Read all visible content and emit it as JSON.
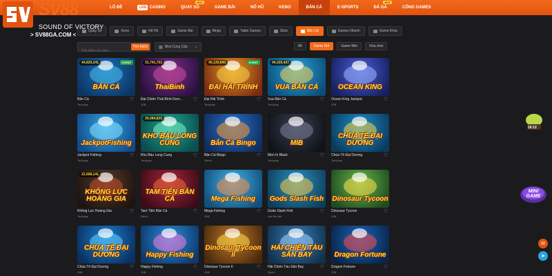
{
  "brand": {
    "logo_text": "SV88",
    "tagline": "SOUND OF VICTORY",
    "url": "> SV88GA.COM <",
    "accent": "#f26a1b"
  },
  "nav": [
    {
      "label": "LÔ ĐỀ",
      "live": false,
      "hot": false,
      "active": false
    },
    {
      "label": "CASINO",
      "live": true,
      "hot": false,
      "active": false
    },
    {
      "label": "QUAY SỐ",
      "live": false,
      "hot": true,
      "active": false
    },
    {
      "label": "GAME BÀI",
      "live": false,
      "hot": false,
      "active": false
    },
    {
      "label": "NỔ HŨ",
      "live": false,
      "hot": false,
      "active": false
    },
    {
      "label": "KENO",
      "live": false,
      "hot": false,
      "active": false
    },
    {
      "label": "BẮN CÁ",
      "live": false,
      "hot": false,
      "active": true
    },
    {
      "label": "E-SPORTS",
      "live": false,
      "hot": false,
      "active": false
    },
    {
      "label": "ĐÁ GÀ",
      "live": false,
      "hot": true,
      "active": false
    },
    {
      "label": "CỔNG GAMES",
      "live": false,
      "hot": false,
      "active": false
    }
  ],
  "nav_badges": {
    "live": "LIVE",
    "hot": "HOT"
  },
  "categories": [
    {
      "label": "Quay Số",
      "active": false
    },
    {
      "label": "Keno",
      "active": false
    },
    {
      "label": "Nổ Hũ",
      "active": false
    },
    {
      "label": "Game Bài",
      "active": false
    },
    {
      "label": "Bingo",
      "active": false
    },
    {
      "label": "Table Games",
      "active": false
    },
    {
      "label": "Slots",
      "active": false
    },
    {
      "label": "Bắn Cá",
      "active": true
    },
    {
      "label": "Games Nhanh",
      "active": false
    },
    {
      "label": "Game Khác",
      "active": false
    }
  ],
  "search": {
    "placeholder": "Tìm kiếm trò chơi...",
    "button": "Tìm Kiếm"
  },
  "provider_select": {
    "value": "Nhà Cung Cấp",
    "chevron": "⌄"
  },
  "filters": [
    {
      "label": "All",
      "active": false
    },
    {
      "label": "Game Hot",
      "active": true
    },
    {
      "label": "Game Mới",
      "active": false
    },
    {
      "label": "Vừa chơi",
      "active": false
    }
  ],
  "games": [
    {
      "name": "Bắn Cá",
      "provider": "Techplay",
      "art_text": "BẮN CÁ",
      "jackpot": "44,829,241",
      "event": "EVENT",
      "c1": "#1d6fb8",
      "c2": "#0c3564",
      "d": "#4ac1f0"
    },
    {
      "name": "Đại Chiến Thái Bình Dươ...",
      "provider": "JDB",
      "art_text": "ThaiBinh",
      "jackpot": "31,741,753",
      "event": "",
      "c1": "#7b2f8a",
      "c2": "#2a1040",
      "d": "#d04d9a"
    },
    {
      "name": "Đại Hải Trình",
      "provider": "Techplay",
      "art_text": "ĐẠI HẢI TRÌNH",
      "jackpot": "45,139,896",
      "event": "EVENT",
      "c1": "#e79a23",
      "c2": "#7a2a10",
      "d": "#f7d04a"
    },
    {
      "name": "Vua Bắn Cá",
      "provider": "Techplay",
      "art_text": "VUA BẮN CÁ",
      "jackpot": "44,325,427",
      "event": "",
      "c1": "#2aa5d8",
      "c2": "#0b4d7a",
      "d": "#ffd44f"
    },
    {
      "name": "Ocean King Jackpot",
      "provider": "JDB",
      "art_text": "OCEAN KING",
      "jackpot": "",
      "event": "",
      "c1": "#4e5fd9",
      "c2": "#162060",
      "d": "#9fb6ff"
    },
    {
      "name": "Jackpot Fishing",
      "provider": "Techplay",
      "art_text": "JackpotFishing",
      "jackpot": "",
      "event": "",
      "c1": "#32a7e6",
      "c2": "#12498a",
      "d": "#8ee2ff"
    },
    {
      "name": "Khu Báu Long Cung",
      "provider": "Techplay",
      "art_text": "KHO BÁU LONG CUNG",
      "jackpot": "30,084,825",
      "event": "",
      "c1": "#1fa68b",
      "c2": "#0b4c50",
      "d": "#7ef0c8"
    },
    {
      "name": "Bắn Cá Bingo",
      "provider": "Qtech",
      "art_text": "Bắn Cá Bingo",
      "jackpot": "",
      "event": "",
      "c1": "#2c72c9",
      "c2": "#0e2e61",
      "d": "#ff9a2e"
    },
    {
      "name": "Men In Black",
      "provider": "Techplay",
      "art_text": "MIB",
      "jackpot": "",
      "event": "",
      "c1": "#3a3f52",
      "c2": "#101218",
      "d": "#7a8198"
    },
    {
      "name": "Chúa Tể Đại Dương",
      "provider": "Techplay",
      "art_text": "CHÚA TỂ ĐẠI DƯƠNG",
      "jackpot": "",
      "event": "",
      "c1": "#1e91c9",
      "c2": "#0a3a5e",
      "d": "#ffd23a"
    },
    {
      "name": "Không Lực Hoàng Gia",
      "provider": "Techplay",
      "art_text": "KHÔNG LỰC HOÀNG GIA",
      "jackpot": "22,668,141",
      "event": "",
      "c1": "#5a3a2a",
      "c2": "#1d1410",
      "d": "#c2502a"
    },
    {
      "name": "Tam Tiên Bắn Cá",
      "provider": "Qtech",
      "art_text": "TAM TIÊN BẮN CÁ",
      "jackpot": "",
      "event": "",
      "c1": "#a8263c",
      "c2": "#3c0b18",
      "d": "#f26a3b"
    },
    {
      "name": "Mega Fishing",
      "provider": "JDB",
      "art_text": "Mega Fishing",
      "jackpot": "",
      "event": "",
      "c1": "#45b0e6",
      "c2": "#10507c",
      "d": "#ff8a3d"
    },
    {
      "name": "Gods Slash Fish",
      "provider": "Ask Me Bet",
      "art_text": "Gods Slash Fish",
      "jackpot": "",
      "event": "",
      "c1": "#2b95c3",
      "c2": "#0d3e5c",
      "d": "#ffc93d"
    },
    {
      "name": "Dinosaur Tycoon",
      "provider": "JDB",
      "art_text": "Dinosaur Tycoon",
      "jackpot": "",
      "event": "",
      "c1": "#6bb84a",
      "c2": "#1f4b22",
      "d": "#ffde4a"
    },
    {
      "name": "Chúa Tể Đại Dương",
      "provider": "JDB",
      "art_text": "CHÚA TỂ ĐẠI DƯƠNG",
      "jackpot": "",
      "event": "",
      "c1": "#1a7fd3",
      "c2": "#09305e",
      "d": "#63d1ff"
    },
    {
      "name": "Happy Fishing",
      "provider": "JDB",
      "art_text": "Happy Fishing",
      "jackpot": "",
      "event": "",
      "c1": "#2c8de0",
      "c2": "#0d3869",
      "d": "#ff7ad9"
    },
    {
      "name": "Dinosaur Tycoon II",
      "provider": "JDB",
      "art_text": "Dinosaur Tycoon II",
      "jackpot": "",
      "event": "",
      "c1": "#c27a2a",
      "c2": "#4a2a0c",
      "d": "#ffde4a"
    },
    {
      "name": "Hải Chiến Tàu Săn Bay",
      "provider": "Qtech",
      "art_text": "HẢI CHIẾN TÀU SĂN BAY",
      "jackpot": "",
      "event": "",
      "c1": "#3a7fb8",
      "c2": "#11314d",
      "d": "#9fd2ff"
    },
    {
      "name": "Dragon Fortune",
      "provider": "JDB",
      "art_text": "Dragon Fortune",
      "jackpot": "",
      "event": "",
      "c1": "#1c66b8",
      "c2": "#08244a",
      "d": "#ff4a4a"
    }
  ],
  "side": {
    "event_label": "16:12",
    "mini_label": "MINI GAME"
  }
}
